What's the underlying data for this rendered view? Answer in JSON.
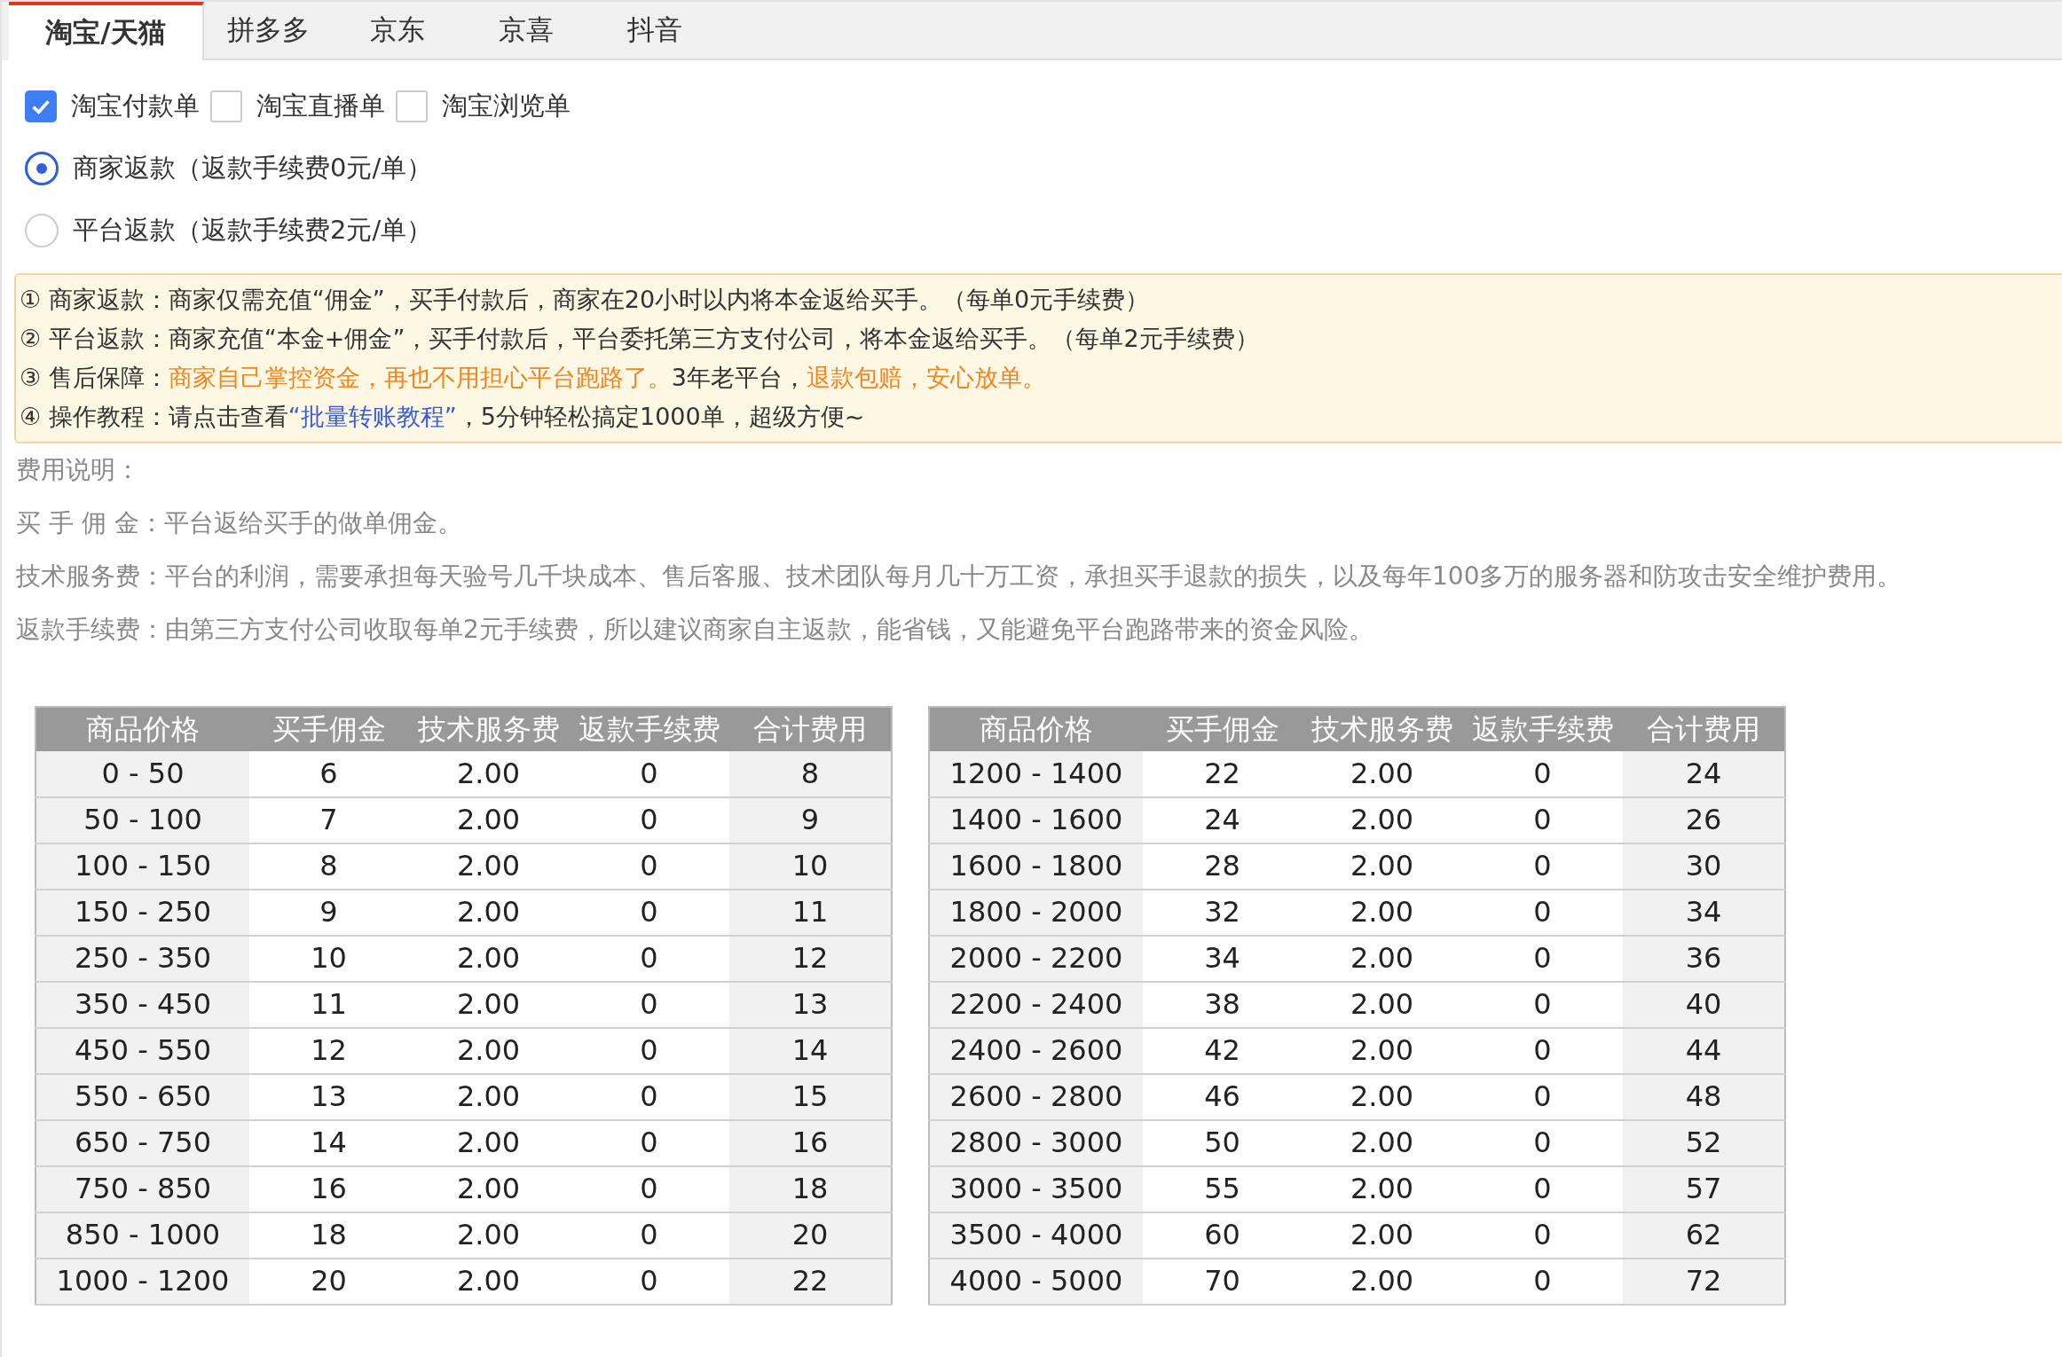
{
  "tabs": [
    {
      "label": "淘宝/天猫",
      "selected": true
    },
    {
      "label": "拼多多",
      "selected": false
    },
    {
      "label": "京东",
      "selected": false
    },
    {
      "label": "京喜",
      "selected": false
    },
    {
      "label": "抖音",
      "selected": false
    }
  ],
  "order_types": [
    {
      "label": "淘宝付款单",
      "checked": true
    },
    {
      "label": "淘宝直播单",
      "checked": false
    },
    {
      "label": "淘宝浏览单",
      "checked": false
    }
  ],
  "refund_options": [
    {
      "label": "商家返款（返款手续费0元/单）",
      "selected": true
    },
    {
      "label": "平台返款（返款手续费2元/单）",
      "selected": false
    }
  ],
  "notices": [
    {
      "parts": [
        {
          "kind": "text",
          "text": "① 商家返款：商家仅需充值“佣金”，买手付款后，商家在20小时以内将本金返给买手。（每单0元手续费）"
        }
      ]
    },
    {
      "parts": [
        {
          "kind": "text",
          "text": "② 平台返款：商家充值“本金+佣金”，买手付款后，平台委托第三方支付公司，将本金返给买手。（每单2元手续费）"
        }
      ]
    },
    {
      "parts": [
        {
          "kind": "text",
          "text": "③ 售后保障："
        },
        {
          "kind": "highlight",
          "text": "商家自己掌控资金，再也不用担心平台跑路了。"
        },
        {
          "kind": "text",
          "text": "3年老平台，"
        },
        {
          "kind": "highlight",
          "text": "退款包赔，安心放单。"
        }
      ]
    },
    {
      "parts": [
        {
          "kind": "text",
          "text": "④ 操作教程：请点击查看"
        },
        {
          "kind": "link",
          "text": "“批量转账教程”"
        },
        {
          "kind": "text",
          "text": "，5分钟轻松搞定1000单，超级方便~"
        }
      ]
    }
  ],
  "fee_explanation": {
    "title": "费用说明：",
    "items": [
      {
        "label": "买 手 佣 金：",
        "text": "平台返给买手的做单佣金。"
      },
      {
        "label": "技术服务费：",
        "text": "平台的利润，需要承担每天验号几千块成本、售后客服、技术团队每月几十万工资，承担买手退款的损失，以及每年100多万的服务器和防攻击安全维护费用。"
      },
      {
        "label": "返款手续费：",
        "text": "由第三方支付公司收取每单2元手续费，所以建议商家自主返款，能省钱，又能避免平台跑路带来的资金风险。"
      }
    ]
  },
  "price_tables": [
    {
      "columns": [
        "商品价格",
        "买手佣金",
        "技术服务费",
        "返款手续费",
        "合计费用"
      ],
      "rows": [
        [
          "0 - 50",
          "6",
          "2.00",
          "0",
          "8"
        ],
        [
          "50 - 100",
          "7",
          "2.00",
          "0",
          "9"
        ],
        [
          "100 - 150",
          "8",
          "2.00",
          "0",
          "10"
        ],
        [
          "150 - 250",
          "9",
          "2.00",
          "0",
          "11"
        ],
        [
          "250 - 350",
          "10",
          "2.00",
          "0",
          "12"
        ],
        [
          "350 - 450",
          "11",
          "2.00",
          "0",
          "13"
        ],
        [
          "450 - 550",
          "12",
          "2.00",
          "0",
          "14"
        ],
        [
          "550 - 650",
          "13",
          "2.00",
          "0",
          "15"
        ],
        [
          "650 - 750",
          "14",
          "2.00",
          "0",
          "16"
        ],
        [
          "750 - 850",
          "16",
          "2.00",
          "0",
          "18"
        ],
        [
          "850 - 1000",
          "18",
          "2.00",
          "0",
          "20"
        ],
        [
          "1000 - 1200",
          "20",
          "2.00",
          "0",
          "22"
        ]
      ]
    },
    {
      "columns": [
        "商品价格",
        "买手佣金",
        "技术服务费",
        "返款手续费",
        "合计费用"
      ],
      "rows": [
        [
          "1200 - 1400",
          "22",
          "2.00",
          "0",
          "24"
        ],
        [
          "1400 - 1600",
          "24",
          "2.00",
          "0",
          "26"
        ],
        [
          "1600 - 1800",
          "28",
          "2.00",
          "0",
          "30"
        ],
        [
          "1800 - 2000",
          "32",
          "2.00",
          "0",
          "34"
        ],
        [
          "2000 - 2200",
          "34",
          "2.00",
          "0",
          "36"
        ],
        [
          "2200 - 2400",
          "38",
          "2.00",
          "0",
          "40"
        ],
        [
          "2400 - 2600",
          "42",
          "2.00",
          "0",
          "44"
        ],
        [
          "2600 - 2800",
          "46",
          "2.00",
          "0",
          "48"
        ],
        [
          "2800 - 3000",
          "50",
          "2.00",
          "0",
          "52"
        ],
        [
          "3000 - 3500",
          "55",
          "2.00",
          "0",
          "57"
        ],
        [
          "3500 - 4000",
          "60",
          "2.00",
          "0",
          "62"
        ],
        [
          "4000 - 5000",
          "70",
          "2.00",
          "0",
          "72"
        ]
      ]
    }
  ]
}
